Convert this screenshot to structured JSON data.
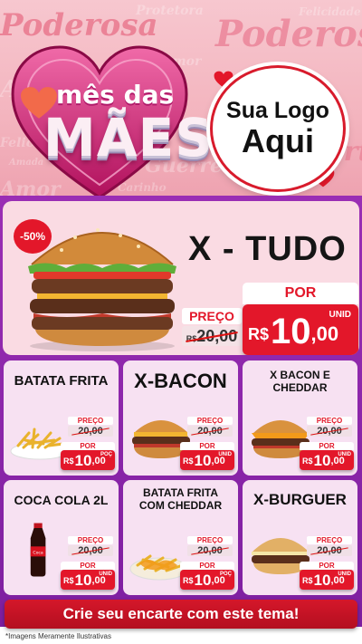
{
  "header": {
    "bg_words": [
      "Poderosa",
      "Protetora",
      "Poderosa",
      "Amor",
      "Felicidade",
      "Amada",
      "Amor",
      "Carinho",
      "Forte",
      "Guerreira",
      "Felicidade",
      "Amor"
    ],
    "campaign_line1": "mês das",
    "campaign_line2": "MÃES",
    "logo_line1": "Sua Logo",
    "logo_line2": "Aqui"
  },
  "featured": {
    "title": "X - TUDO",
    "discount": "-50%",
    "preco_label": "PREÇO",
    "old_currency": "R$",
    "old_price": "20,00",
    "por_label": "POR",
    "currency": "R$",
    "price_int": "10",
    "price_cents": ",00",
    "unit": "UNID"
  },
  "products": [
    {
      "title": "BATATA FRITA",
      "preco_label": "PREÇO",
      "old_price": "20,00",
      "por_label": "POR",
      "currency": "R$",
      "price_int": "10",
      "price_cents": ",00",
      "unit": "POÇ"
    },
    {
      "title": "X-BACON",
      "preco_label": "PREÇO",
      "old_price": "20,00",
      "por_label": "POR",
      "currency": "R$",
      "price_int": "10",
      "price_cents": ",00",
      "unit": "UNID"
    },
    {
      "title": "X BACON E CHEDDAR",
      "preco_label": "PREÇO",
      "old_price": "20,00",
      "por_label": "POR",
      "currency": "R$",
      "price_int": "10",
      "price_cents": ",00",
      "unit": "UNID"
    },
    {
      "title": "COCA COLA 2L",
      "preco_label": "PREÇO",
      "old_price": "20,00",
      "por_label": "POR",
      "currency": "R$",
      "price_int": "10",
      "price_cents": ",00",
      "unit": "UNID"
    },
    {
      "title": "BATATA FRITA COM CHEDDAR",
      "preco_label": "PREÇO",
      "old_price": "20,00",
      "por_label": "POR",
      "currency": "R$",
      "price_int": "10",
      "price_cents": ",00",
      "unit": "POÇ"
    },
    {
      "title": "X-BURGUER",
      "preco_label": "PREÇO",
      "old_price": "20,00",
      "por_label": "POR",
      "currency": "R$",
      "price_int": "10",
      "price_cents": ",00",
      "unit": "UNID"
    }
  ],
  "cta": "Crie seu encarte com este tema!",
  "footnote": "*Imagens Meramente Ilustrativas",
  "colors": {
    "accent_red": "#e3172a",
    "panel_purple": "#8d27ab",
    "card_bg": "#f7e1f2",
    "header_pink": "#f3b4be"
  }
}
